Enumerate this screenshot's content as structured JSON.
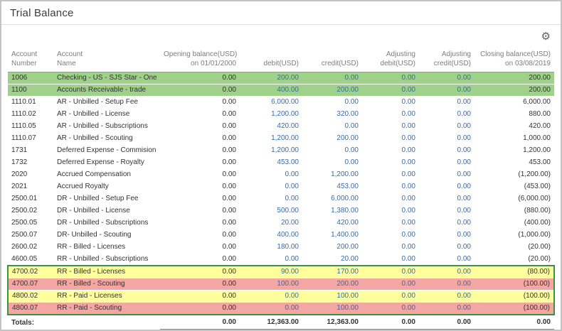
{
  "page": {
    "title": "Trial Balance"
  },
  "toolbar": {
    "gear_icon_glyph": "⚙"
  },
  "colors": {
    "highlight_green": "#9fd18a",
    "highlight_yellow": "#ffff9c",
    "highlight_red": "#f4a6a2",
    "box_green": "#3d9140",
    "link_blue": "#2f6db6",
    "header_gray": "#7d7d7d",
    "text_dark": "#333333"
  },
  "table": {
    "columns": [
      {
        "line1": "Account",
        "line2": "Number"
      },
      {
        "line1": "Account",
        "line2": "Name"
      },
      {
        "line1": "Opening balance(USD)",
        "line2": "on 01/01/2000"
      },
      {
        "line1": "",
        "line2": "debit(USD)"
      },
      {
        "line1": "",
        "line2": "credit(USD)"
      },
      {
        "line1": "Adjusting",
        "line2": "debit(USD)"
      },
      {
        "line1": "Adjusting",
        "line2": "credit(USD)"
      },
      {
        "line1": "Closing balance(USD)",
        "line2": "on 03/08/2019"
      }
    ],
    "rows": [
      {
        "number": "1006",
        "name": "Checking - US - SJS Star - One",
        "opening": "0.00",
        "debit": "200.00",
        "credit": "0.00",
        "adj_debit": "0.00",
        "adj_credit": "0.00",
        "closing": "200.00",
        "highlight": "green",
        "box": false
      },
      {
        "number": "1100",
        "name": "Accounts Receivable - trade",
        "opening": "0.00",
        "debit": "400.00",
        "credit": "200.00",
        "adj_debit": "0.00",
        "adj_credit": "0.00",
        "closing": "200.00",
        "highlight": "green",
        "box": false
      },
      {
        "number": "1110.01",
        "name": "AR - Unbilled - Setup Fee",
        "opening": "0.00",
        "debit": "6,000.00",
        "credit": "0.00",
        "adj_debit": "0.00",
        "adj_credit": "0.00",
        "closing": "6,000.00",
        "highlight": null,
        "box": false
      },
      {
        "number": "1110.02",
        "name": "AR - Unbilled - License",
        "opening": "0.00",
        "debit": "1,200.00",
        "credit": "320.00",
        "adj_debit": "0.00",
        "adj_credit": "0.00",
        "closing": "880.00",
        "highlight": null,
        "box": false
      },
      {
        "number": "1110.05",
        "name": "AR - Unbilled - Subscriptions",
        "opening": "0.00",
        "debit": "420.00",
        "credit": "0.00",
        "adj_debit": "0.00",
        "adj_credit": "0.00",
        "closing": "420.00",
        "highlight": null,
        "box": false
      },
      {
        "number": "1110.07",
        "name": "AR - Unbilled - Scouting",
        "opening": "0.00",
        "debit": "1,200.00",
        "credit": "200.00",
        "adj_debit": "0.00",
        "adj_credit": "0.00",
        "closing": "1,000.00",
        "highlight": null,
        "box": false
      },
      {
        "number": "1731",
        "name": "Deferred Expense - Commision",
        "opening": "0.00",
        "debit": "1,200.00",
        "credit": "0.00",
        "adj_debit": "0.00",
        "adj_credit": "0.00",
        "closing": "1,200.00",
        "highlight": null,
        "box": false
      },
      {
        "number": "1732",
        "name": "Deferred Expense - Royalty",
        "opening": "0.00",
        "debit": "453.00",
        "credit": "0.00",
        "adj_debit": "0.00",
        "adj_credit": "0.00",
        "closing": "453.00",
        "highlight": null,
        "box": false
      },
      {
        "number": "2020",
        "name": "Accrued Compensation",
        "opening": "0.00",
        "debit": "0.00",
        "credit": "1,200.00",
        "adj_debit": "0.00",
        "adj_credit": "0.00",
        "closing": "(1,200.00)",
        "highlight": null,
        "box": false
      },
      {
        "number": "2021",
        "name": "Accrued Royalty",
        "opening": "0.00",
        "debit": "0.00",
        "credit": "453.00",
        "adj_debit": "0.00",
        "adj_credit": "0.00",
        "closing": "(453.00)",
        "highlight": null,
        "box": false
      },
      {
        "number": "2500.01",
        "name": "DR - Unbilled - Setup Fee",
        "opening": "0.00",
        "debit": "0.00",
        "credit": "6,000.00",
        "adj_debit": "0.00",
        "adj_credit": "0.00",
        "closing": "(6,000.00)",
        "highlight": null,
        "box": false
      },
      {
        "number": "2500.02",
        "name": "DR - Unbilled - License",
        "opening": "0.00",
        "debit": "500.00",
        "credit": "1,380.00",
        "adj_debit": "0.00",
        "adj_credit": "0.00",
        "closing": "(880.00)",
        "highlight": null,
        "box": false
      },
      {
        "number": "2500.05",
        "name": "DR - Unbilled - Subscriptions",
        "opening": "0.00",
        "debit": "20.00",
        "credit": "420.00",
        "adj_debit": "0.00",
        "adj_credit": "0.00",
        "closing": "(400.00)",
        "highlight": null,
        "box": false
      },
      {
        "number": "2500.07",
        "name": "DR- Unbilled - Scouting",
        "opening": "0.00",
        "debit": "400.00",
        "credit": "1,400.00",
        "adj_debit": "0.00",
        "adj_credit": "0.00",
        "closing": "(1,000.00)",
        "highlight": null,
        "box": false
      },
      {
        "number": "2600.02",
        "name": "RR - Billed - Licenses",
        "opening": "0.00",
        "debit": "180.00",
        "credit": "200.00",
        "adj_debit": "0.00",
        "adj_credit": "0.00",
        "closing": "(20.00)",
        "highlight": null,
        "box": false
      },
      {
        "number": "4600.05",
        "name": "RR - Unbilled - Subscriptions",
        "opening": "0.00",
        "debit": "0.00",
        "credit": "20.00",
        "adj_debit": "0.00",
        "adj_credit": "0.00",
        "closing": "(20.00)",
        "highlight": null,
        "box": false
      },
      {
        "number": "4700.02",
        "name": "RR - Billed - Licenses",
        "opening": "0.00",
        "debit": "90.00",
        "credit": "170.00",
        "adj_debit": "0.00",
        "adj_credit": "0.00",
        "closing": "(80.00)",
        "highlight": "yellow",
        "box": true
      },
      {
        "number": "4700.07",
        "name": "RR - Billed - Scouting",
        "opening": "0.00",
        "debit": "100.00",
        "credit": "200.00",
        "adj_debit": "0.00",
        "adj_credit": "0.00",
        "closing": "(100.00)",
        "highlight": "red",
        "box": true
      },
      {
        "number": "4800.02",
        "name": "RR - Paid - Licenses",
        "opening": "0.00",
        "debit": "0.00",
        "credit": "100.00",
        "adj_debit": "0.00",
        "adj_credit": "0.00",
        "closing": "(100.00)",
        "highlight": "yellow",
        "box": true
      },
      {
        "number": "4800.07",
        "name": "RR - Paid - Scouting",
        "opening": "0.00",
        "debit": "0.00",
        "credit": "100.00",
        "adj_debit": "0.00",
        "adj_credit": "0.00",
        "closing": "(100.00)",
        "highlight": "red",
        "box": true
      }
    ],
    "totals": {
      "label": "Totals:",
      "opening": "0.00",
      "debit": "12,363.00",
      "credit": "12,363.00",
      "adj_debit": "0.00",
      "adj_credit": "0.00",
      "closing": "0.00"
    }
  }
}
